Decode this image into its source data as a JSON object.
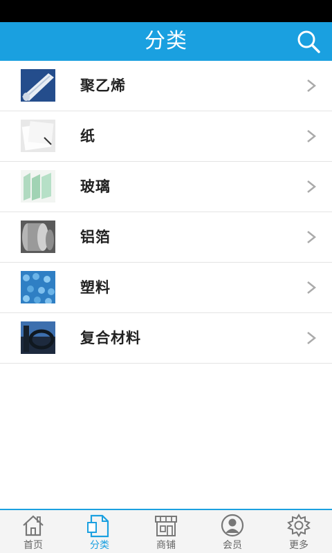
{
  "header": {
    "title": "分类",
    "search_icon": "search-icon"
  },
  "categories": [
    {
      "label": "聚乙烯",
      "thumb": "polyethylene-thumbnail"
    },
    {
      "label": "纸",
      "thumb": "paper-thumbnail"
    },
    {
      "label": "玻璃",
      "thumb": "glass-thumbnail"
    },
    {
      "label": "铝箔",
      "thumb": "aluminum-foil-thumbnail"
    },
    {
      "label": "塑料",
      "thumb": "plastic-thumbnail"
    },
    {
      "label": "复合材料",
      "thumb": "composite-thumbnail"
    }
  ],
  "tabbar": {
    "active": "分类",
    "tabs": [
      {
        "label": "首页",
        "icon": "home-icon"
      },
      {
        "label": "分类",
        "icon": "category-icon"
      },
      {
        "label": "商铺",
        "icon": "shop-icon"
      },
      {
        "label": "会员",
        "icon": "member-icon"
      },
      {
        "label": "更多",
        "icon": "gear-icon"
      }
    ]
  },
  "colors": {
    "accent": "#1aa0e0",
    "status_bar": "#000000",
    "tab_inactive": "#666666"
  }
}
